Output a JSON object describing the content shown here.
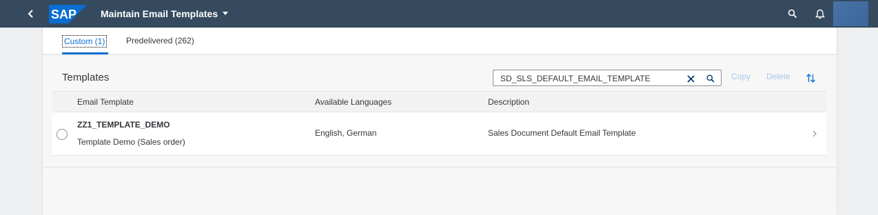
{
  "shell": {
    "logo_text": "SAP",
    "title": "Maintain Email Templates",
    "icons": {
      "back": "back-chevron-icon",
      "title_dropdown": "caret-down-icon",
      "search": "search-icon",
      "notifications": "bell-icon",
      "avatar": "user-avatar"
    },
    "colors": {
      "bar": "#354a5f",
      "logo": "#0a6ed1"
    }
  },
  "tabs": [
    {
      "label": "Custom (1)",
      "selected": true
    },
    {
      "label": "Predelivered (262)",
      "selected": false
    }
  ],
  "toolbar": {
    "title": "Templates",
    "search_value": "SD_SLS_DEFAULT_EMAIL_TEMPLATE",
    "copy_label": "Copy",
    "delete_label": "Delete",
    "icons": {
      "clear": "clear-x-icon",
      "search": "search-icon",
      "sort": "sort-icon"
    }
  },
  "table": {
    "columns": [
      "Email Template",
      "Available Languages",
      "Description"
    ],
    "rows": [
      {
        "name": "ZZ1_TEMPLATE_DEMO",
        "subtitle": "Template Demo (Sales order)",
        "languages": "English, German",
        "description": "Sales Document Default Email Template"
      }
    ]
  }
}
